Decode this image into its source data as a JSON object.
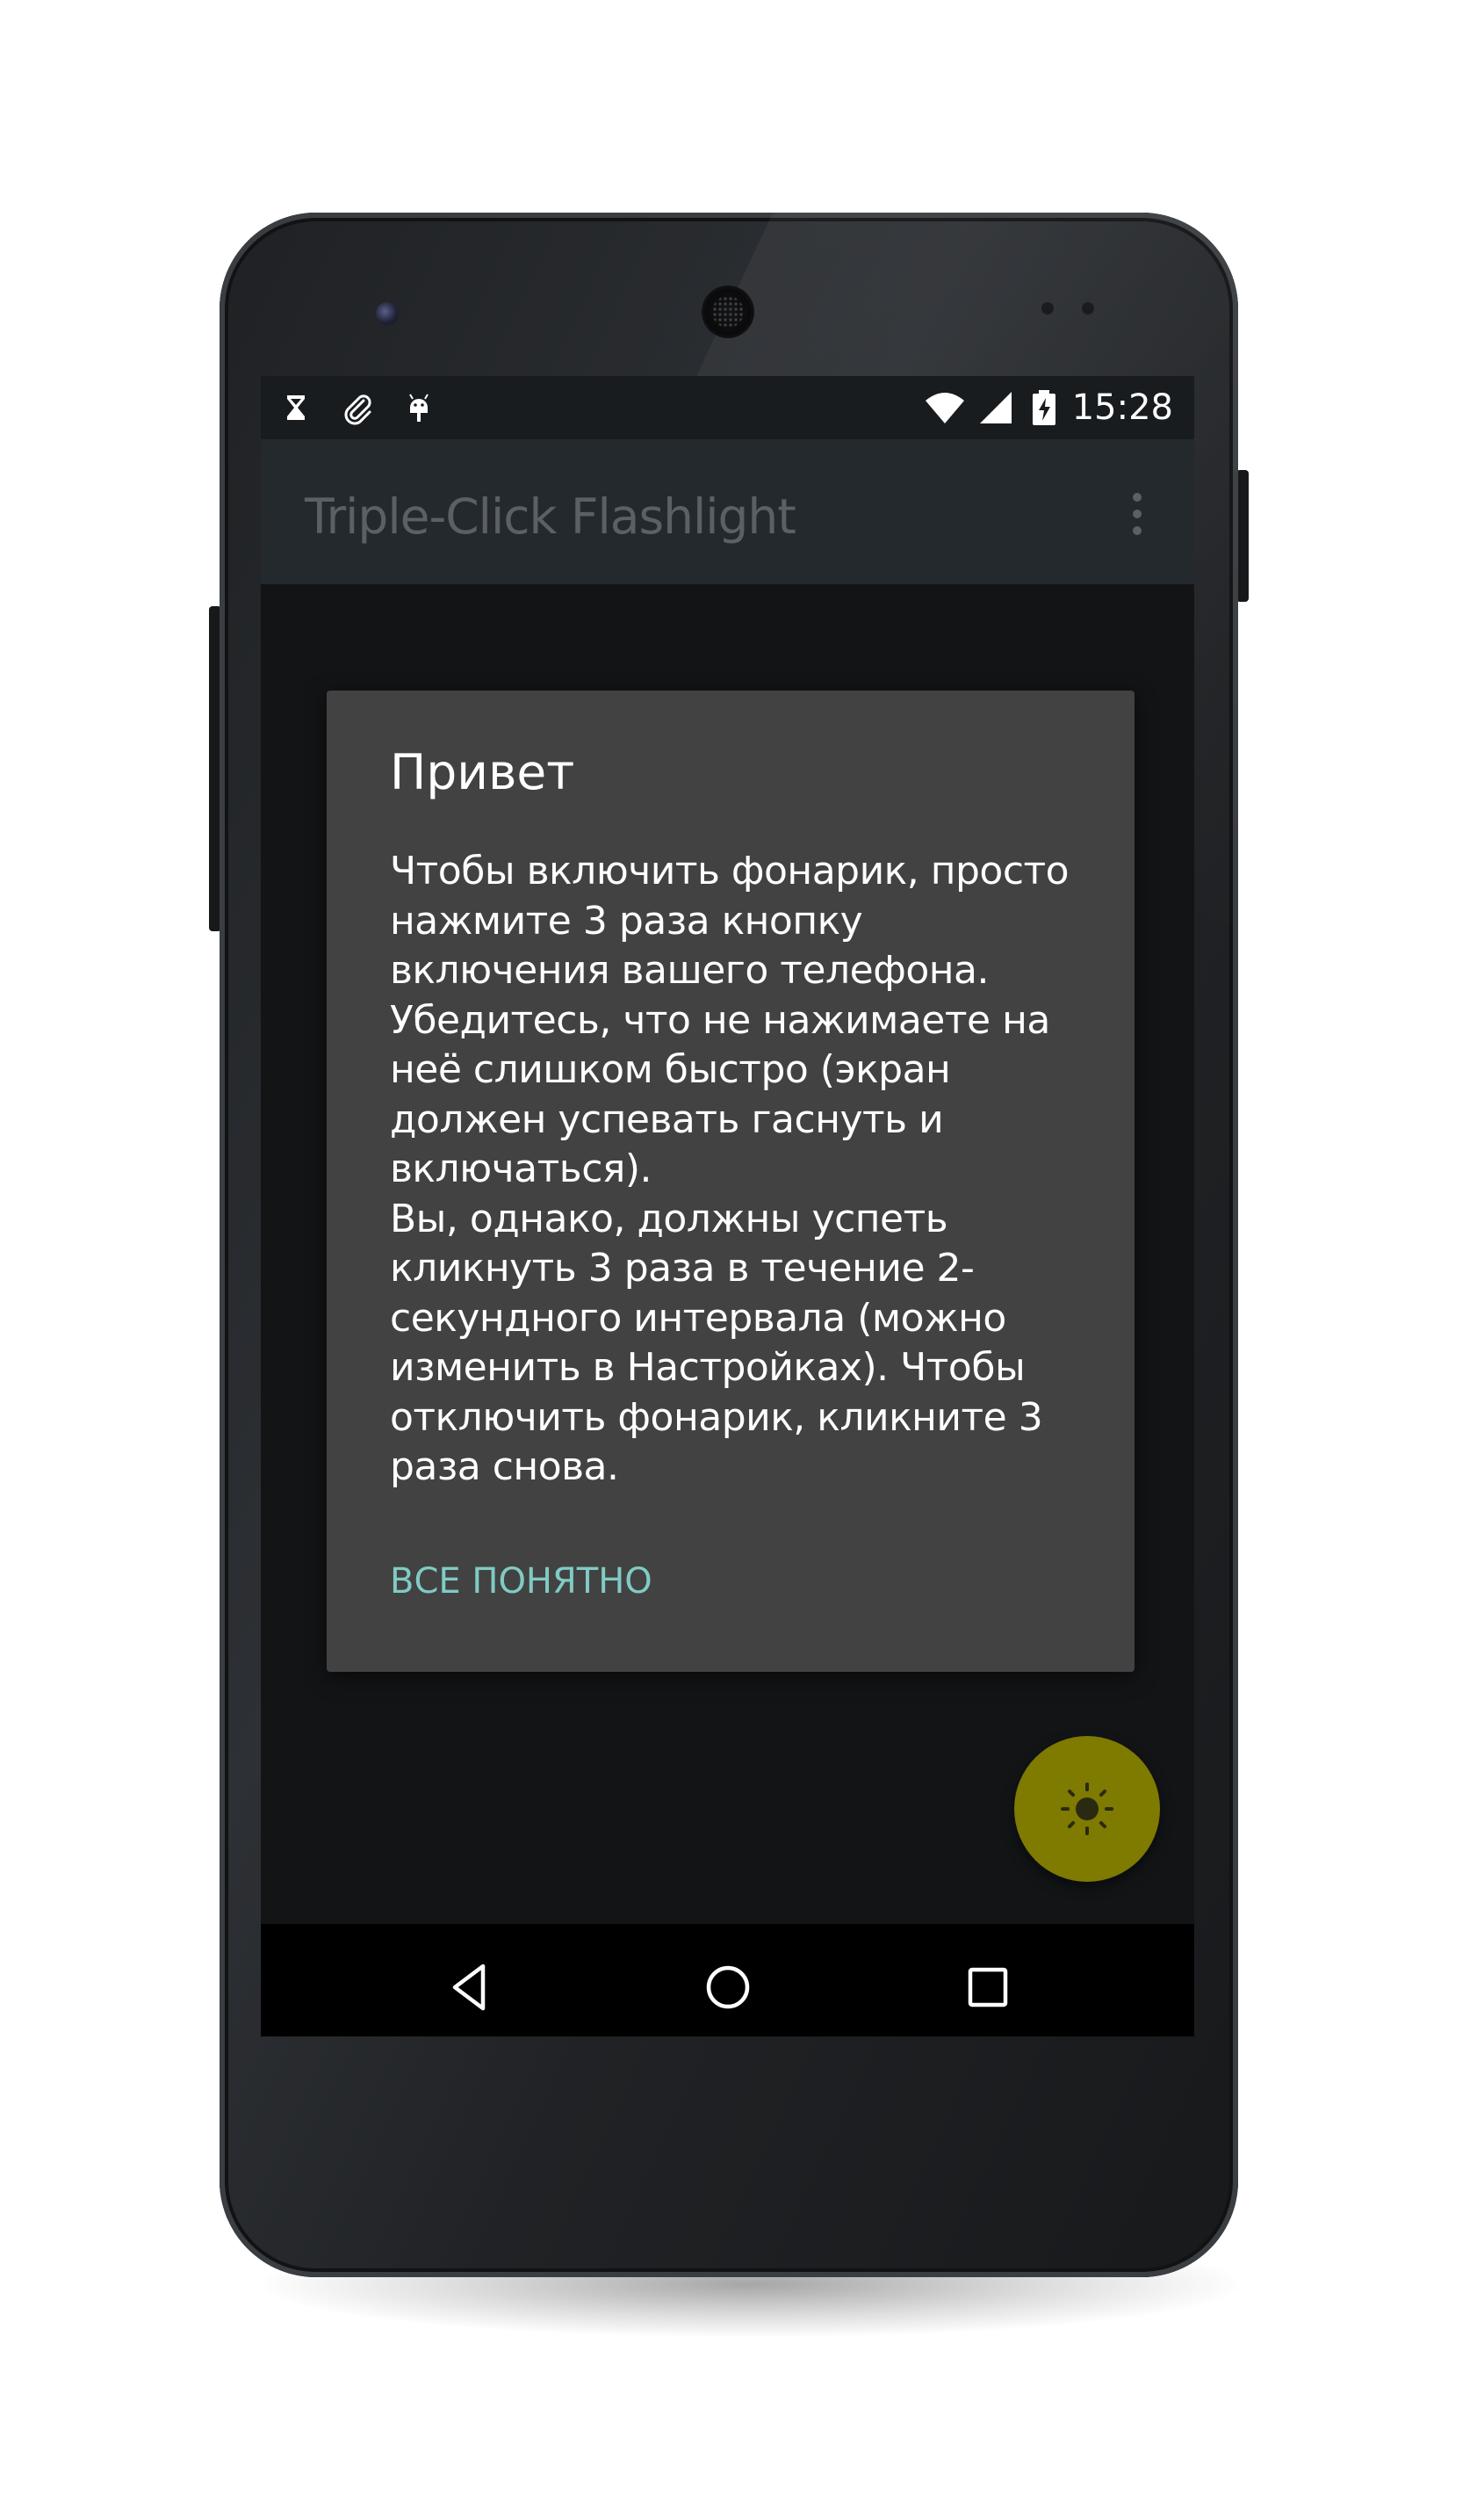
{
  "status_bar": {
    "time": "15:28",
    "left_icons": [
      "hourglass-icon",
      "paperclip-icon",
      "android-debug-icon"
    ],
    "right_icons": [
      "wifi-icon",
      "cell-signal-icon",
      "battery-charging-icon"
    ]
  },
  "app_bar": {
    "title": "Triple-Click Flashlight",
    "menu_icon": "overflow-menu-icon"
  },
  "dialog": {
    "title": "Привет",
    "message": "Чтобы включить фонарик, просто\nнажмите 3 раза кнопку\nвключения вашего телефона.\nУбедитесь, что не нажимаете на\nнеё слишком быстро (экран\nдолжен успевать гаснуть и\nвключаться).\nВы, однако, должны успеть\nкликнуть 3 раза в течение 2-\nсекундного интервала (можно\nизменить в Настройках). Чтобы\nотключить фонарик, кликните 3\nраза снова.",
    "button_label": "ВСЕ ПОНЯТНО",
    "accent_color": "#80cbc4"
  },
  "fab": {
    "icon": "brightness-icon",
    "color": "#7f7a00"
  },
  "nav_bar": {
    "icons": [
      "back-icon",
      "home-icon",
      "recents-icon"
    ]
  }
}
